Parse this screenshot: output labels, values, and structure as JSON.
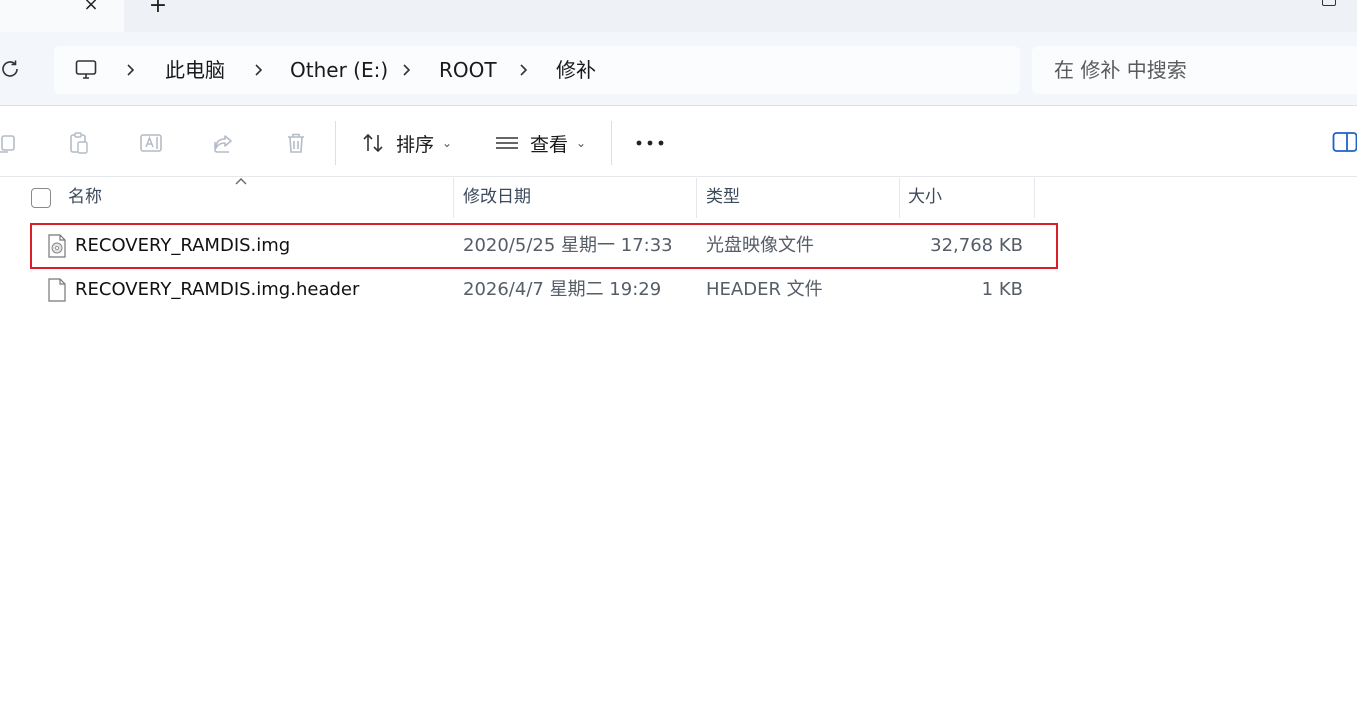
{
  "tabs": {
    "close_label": "×",
    "new_tab_label": "+"
  },
  "address": {
    "crumbs": [
      "此电脑",
      "Other (E:)",
      "ROOT",
      "修补"
    ],
    "search_placeholder": "在 修补 中搜索"
  },
  "toolbar": {
    "sort_label": "排序",
    "view_label": "查看"
  },
  "columns": {
    "name": "名称",
    "date": "修改日期",
    "type": "类型",
    "size": "大小"
  },
  "files": [
    {
      "name": "RECOVERY_RAMDIS.img",
      "modified": "2020/5/25 星期一 17:33",
      "type": "光盘映像文件",
      "size": "32,768 KB",
      "icon": "disc-image-file-icon",
      "highlighted": true
    },
    {
      "name": "RECOVERY_RAMDIS.img.header",
      "modified": "2026/4/7 星期二 19:29",
      "type": "HEADER 文件",
      "size": "1 KB",
      "icon": "blank-file-icon",
      "highlighted": false
    }
  ],
  "colors": {
    "highlight_outline": "#d9202a",
    "address_bg": "#f3f6fb",
    "tabstrip_bg": "#eef1f6"
  }
}
